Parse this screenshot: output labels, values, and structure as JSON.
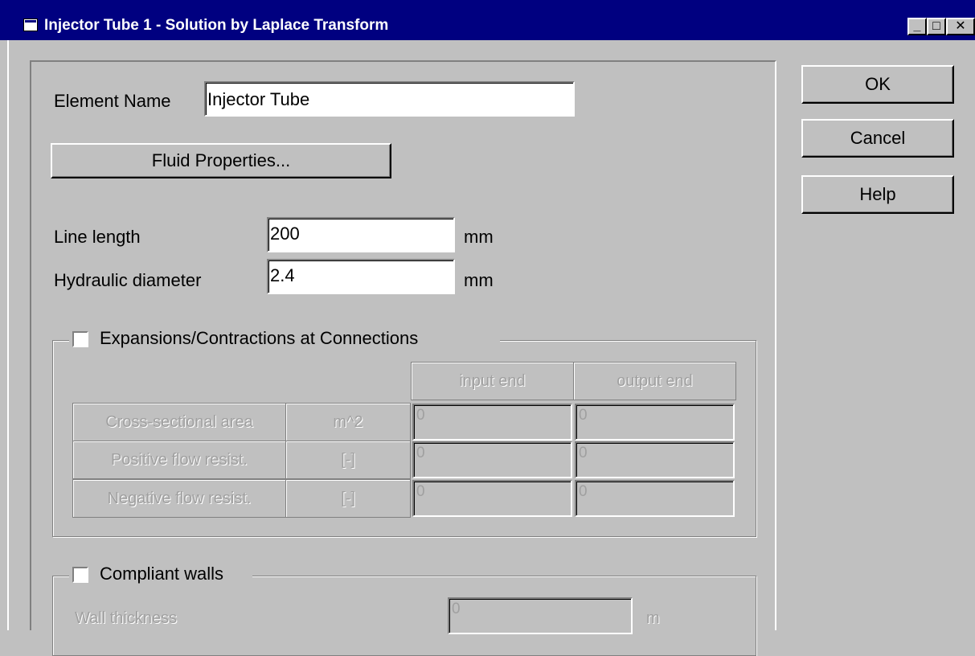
{
  "window": {
    "title": "Injector Tube 1 - Solution by Laplace Transform",
    "minimize_glyph": "_",
    "maximize_glyph": "□",
    "close_glyph": "✕"
  },
  "form": {
    "element_name_label": "Element Name",
    "element_name_value": "Injector Tube",
    "fluid_properties_button": "Fluid Properties...",
    "line_length_label": "Line length",
    "line_length_value": "200",
    "line_length_unit": "mm",
    "hydraulic_diameter_label": "Hydraulic diameter",
    "hydraulic_diameter_value": "2.4",
    "hydraulic_diameter_unit": "mm"
  },
  "expansions": {
    "label": "Expansions/Contractions at Connections",
    "checked": false,
    "columns": [
      "input end",
      "output end"
    ],
    "rows": [
      {
        "name": "Cross-sectional area",
        "unit": "m^2",
        "input": "0",
        "output": "0"
      },
      {
        "name": "Positive flow resist.",
        "unit": "[-]",
        "input": "0",
        "output": "0"
      },
      {
        "name": "Negative flow resist.",
        "unit": "[-]",
        "input": "0",
        "output": "0"
      }
    ]
  },
  "compliant": {
    "label": "Compliant walls",
    "checked": false,
    "wall_thickness_label": "Wall thickness",
    "wall_thickness_value": "0",
    "wall_thickness_unit": "m"
  },
  "buttons": {
    "ok": "OK",
    "cancel": "Cancel",
    "help": "Help"
  },
  "colors": {
    "titlebar": "#000080",
    "face": "#c0c0c0",
    "disabled_text": "#a0a0a0"
  }
}
